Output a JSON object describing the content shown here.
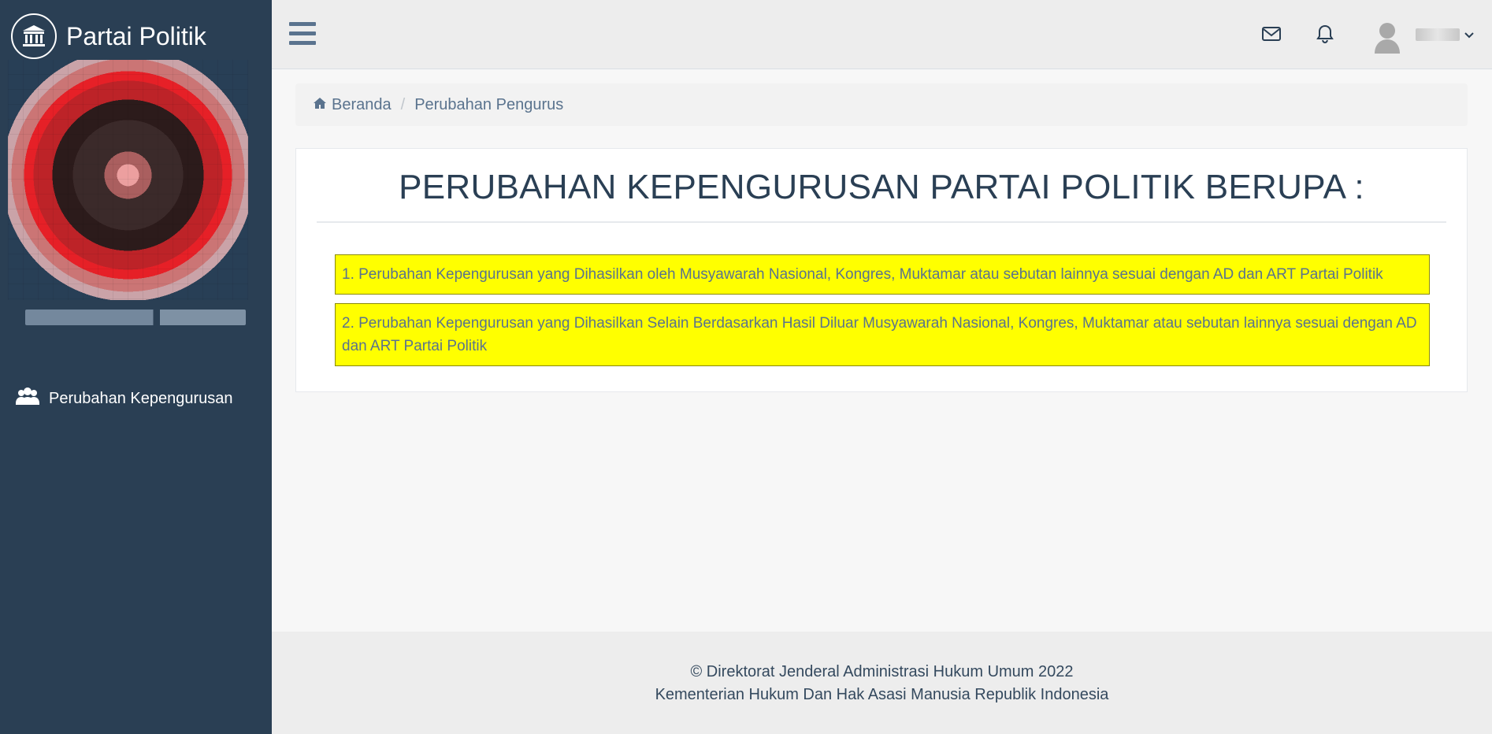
{
  "app": {
    "title": "Partai Politik"
  },
  "sidebar": {
    "menu": [
      {
        "label": "Perubahan Kepengurusan",
        "icon": "users-icon"
      }
    ]
  },
  "topbar": {
    "icons": [
      "menu-icon",
      "mail-icon",
      "bell-icon",
      "user-avatar-icon",
      "chevron-down-icon"
    ]
  },
  "breadcrumb": {
    "home_label": "Beranda",
    "current_label": "Perubahan Pengurus"
  },
  "panel": {
    "title": "PERUBAHAN KEPENGURUSAN PARTAI POLITIK BERUPA :",
    "options": [
      "1. Perubahan Kepengurusan yang Dihasilkan oleh Musyawarah Nasional, Kongres, Muktamar atau sebutan lainnya sesuai dengan AD dan ART Partai Politik",
      "2. Perubahan Kepengurusan yang Dihasilkan Selain Berdasarkan Hasil Diluar Musyawarah Nasional, Kongres, Muktamar atau sebutan lainnya sesuai dengan AD dan ART Partai Politik"
    ]
  },
  "footer": {
    "line1": "© Direktorat Jenderal Administrasi Hukum Umum 2022",
    "line2": "Kementerian Hukum Dan Hak Asasi Manusia Republik Indonesia"
  },
  "colors": {
    "sidebar": "#2a3f54",
    "highlight": "#ffff00",
    "text": "#5a738e"
  }
}
